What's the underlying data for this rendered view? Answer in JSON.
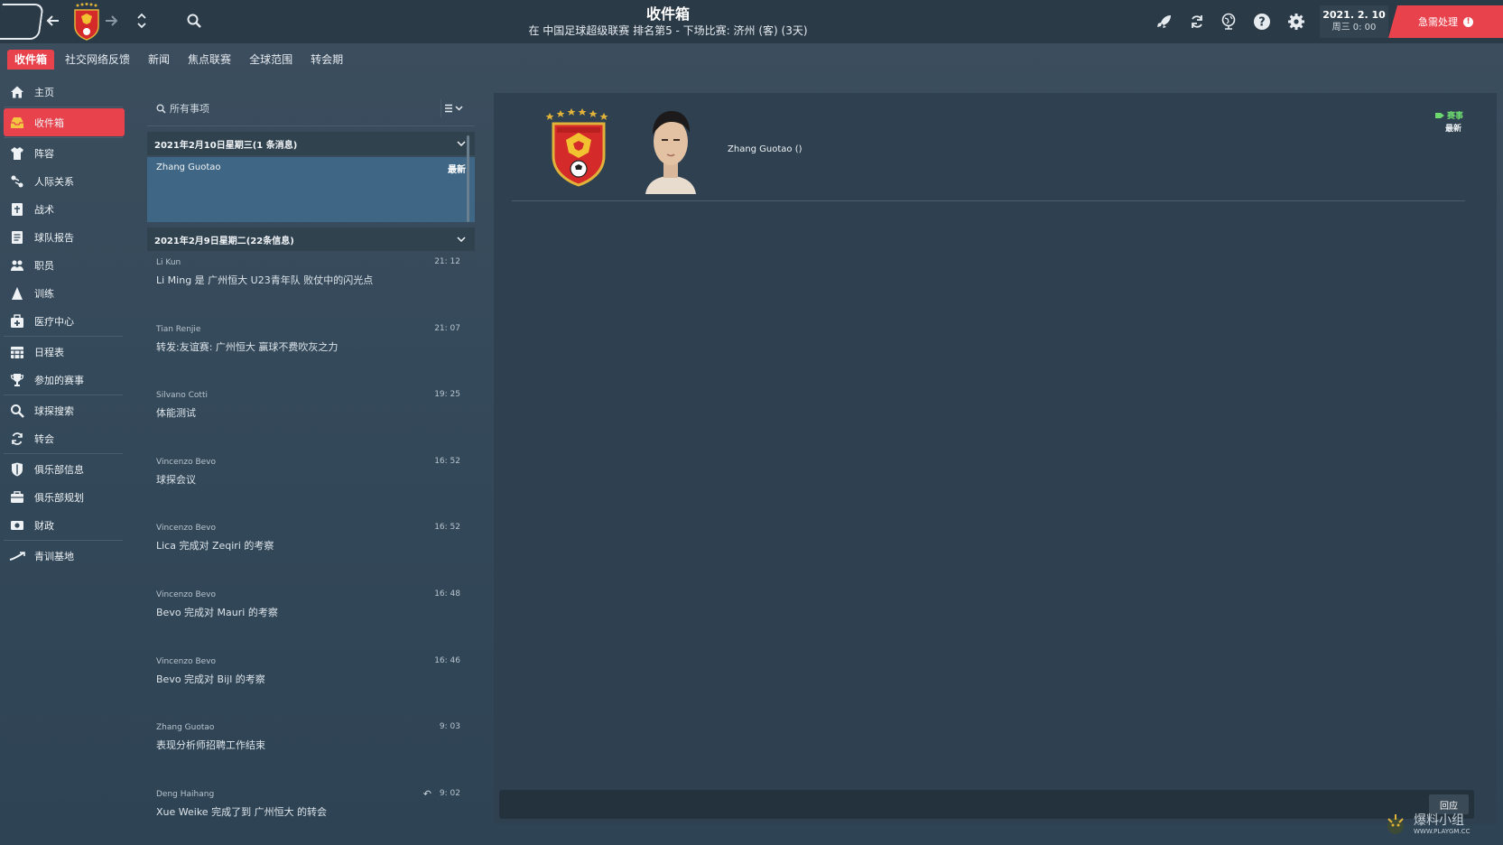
{
  "header": {
    "title": "收件箱",
    "subtitle": "在 中国足球超级联赛 排名第5 - 下场比赛: 济州 (客) (3天)",
    "date": "2021. 2. 10",
    "day_time": "周三 0: 00",
    "urgent_label": "急需处理",
    "urgent_count": "!"
  },
  "tabs": [
    {
      "label": "收件箱",
      "active": true
    },
    {
      "label": "社交网络反馈"
    },
    {
      "label": "新闻"
    },
    {
      "label": "焦点联赛"
    },
    {
      "label": "全球范围"
    },
    {
      "label": "转会期"
    }
  ],
  "sidebar": {
    "items": [
      {
        "label": "主页",
        "icon": "home-icon"
      },
      {
        "label": "收件箱",
        "icon": "inbox-icon",
        "active": true
      },
      {
        "label": "阵容",
        "icon": "shirt-icon"
      },
      {
        "label": "人际关系",
        "icon": "relationships-icon"
      },
      {
        "label": "战术",
        "icon": "tactics-icon"
      },
      {
        "label": "球队报告",
        "icon": "report-icon"
      },
      {
        "label": "职员",
        "icon": "staff-icon"
      },
      {
        "label": "训练",
        "icon": "training-icon"
      },
      {
        "label": "医疗中心",
        "icon": "medical-icon"
      },
      {
        "label": "日程表",
        "icon": "calendar-icon"
      },
      {
        "label": "参加的赛事",
        "icon": "trophy-icon"
      },
      {
        "label": "球探搜索",
        "icon": "scouting-icon"
      },
      {
        "label": "转会",
        "icon": "transfer-icon"
      },
      {
        "label": "俱乐部信息",
        "icon": "shield-icon"
      },
      {
        "label": "俱乐部规划",
        "icon": "briefcase-icon"
      },
      {
        "label": "财政",
        "icon": "finance-icon"
      },
      {
        "label": "青训基地",
        "icon": "youth-icon"
      }
    ]
  },
  "list": {
    "search_placeholder": "所有事项",
    "groups": [
      {
        "header": "2021年2月10日星期三(1 条消息)"
      },
      {
        "header": "2021年2月9日星期二(22条信息)"
      }
    ],
    "selected": {
      "from": "Zhang Guotao",
      "badge": "最新"
    },
    "messages": [
      {
        "from": "Li Kun",
        "time": "21: 12",
        "subject": "Li Ming 是 广州恒大 U23青年队 败仗中的闪光点"
      },
      {
        "from": "Tian Renjie",
        "time": "21: 07",
        "subject": "转发:友谊赛: 广州恒大 赢球不费吹灰之力"
      },
      {
        "from": "Silvano Cotti",
        "time": "19: 25",
        "subject": "体能测试"
      },
      {
        "from": "Vincenzo Bevo",
        "time": "16: 52",
        "subject": "球探会议"
      },
      {
        "from": "Vincenzo Bevo",
        "time": "16: 52",
        "subject": "Lica 完成对 Zeqiri 的考察"
      },
      {
        "from": "Vincenzo Bevo",
        "time": "16: 48",
        "subject": "Bevo 完成对 Mauri 的考察"
      },
      {
        "from": "Vincenzo Bevo",
        "time": "16: 46",
        "subject": "Bevo 完成对 Bijl 的考察"
      },
      {
        "from": "Zhang Guotao",
        "time": "9: 03",
        "subject": "表现分析师招聘工作结束"
      },
      {
        "from": "Deng Haihang",
        "time": "9: 02",
        "subject": "Xue Weike 完成了到 广州恒大 的转会",
        "replied": true
      }
    ]
  },
  "detail": {
    "sender": "Zhang Guotao ()",
    "tag": "赛事",
    "tag_new": "最新",
    "reply_label": "回应"
  },
  "watermark": {
    "text": "爆料小组",
    "url": "WWW.PLAYGM.CC"
  },
  "colors": {
    "accent": "#e8424d",
    "selected_row": "#3f6785",
    "tag_green": "#6cd86e"
  }
}
